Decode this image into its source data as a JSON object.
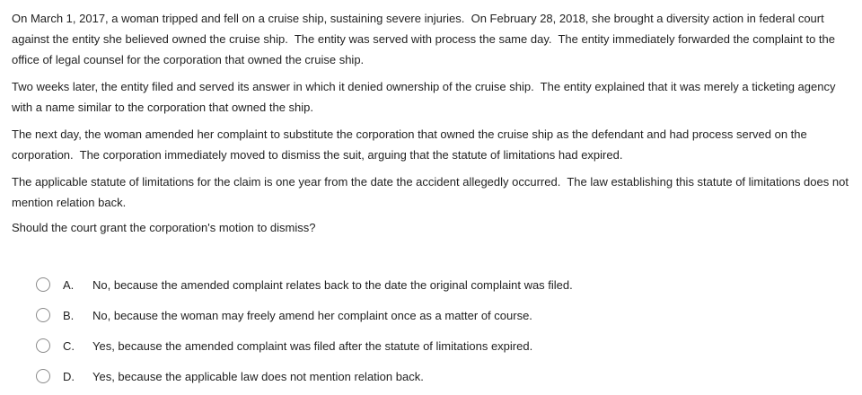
{
  "question": {
    "paragraphs": [
      "On March 1, 2017, a woman tripped and fell on a cruise ship, sustaining severe injuries.  On February 28, 2018, she brought a diversity action in federal court against the entity she believed owned the cruise ship.  The entity was served with process the same day.  The entity immediately forwarded the complaint to the office of legal counsel for the corporation that owned the cruise ship.",
      "Two weeks later, the entity filed and served its answer in which it denied ownership of the cruise ship.  The entity explained that it was merely a ticketing agency with a name similar to the corporation that owned the ship.",
      "The next day, the woman amended her complaint to substitute the corporation that owned the cruise ship as the defendant and had process served on the corporation.  The corporation immediately moved to dismiss the suit, arguing that the statute of limitations had expired.",
      "The applicable statute of limitations for the claim is one year from the date the accident allegedly occurred.  The law establishing this statute of limitations does not mention relation back."
    ],
    "prompt": "Should the court grant the corporation's motion to dismiss?"
  },
  "options": [
    {
      "letter": "A.",
      "text": "No, because the amended complaint relates back to the date the original complaint was filed."
    },
    {
      "letter": "B.",
      "text": "No, because the woman may freely amend her complaint once as a matter of course."
    },
    {
      "letter": "C.",
      "text": "Yes, because the amended complaint was filed after the statute of limitations expired."
    },
    {
      "letter": "D.",
      "text": "Yes, because the applicable law does not mention relation back."
    }
  ]
}
